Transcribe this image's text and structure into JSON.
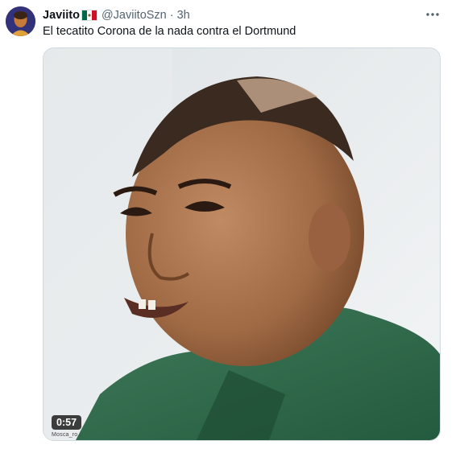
{
  "tweet": {
    "author": {
      "display_name": "Javiito",
      "flag_icon": "mexico-flag-icon",
      "handle": "@JaviitoSzn",
      "separator": "·",
      "time": "3h"
    },
    "more_icon": "more-horizontal-icon",
    "text": "El tecatito Corona de la nada contra el Dortmund",
    "media": {
      "type": "video",
      "duration": "0:57",
      "watermark": "Mosca_ro..."
    }
  },
  "colors": {
    "text_primary": "#0f1419",
    "text_secondary": "#536471",
    "border": "#cfd9de",
    "flag_green": "#006847",
    "flag_white": "#ffffff",
    "flag_red": "#ce1126"
  }
}
